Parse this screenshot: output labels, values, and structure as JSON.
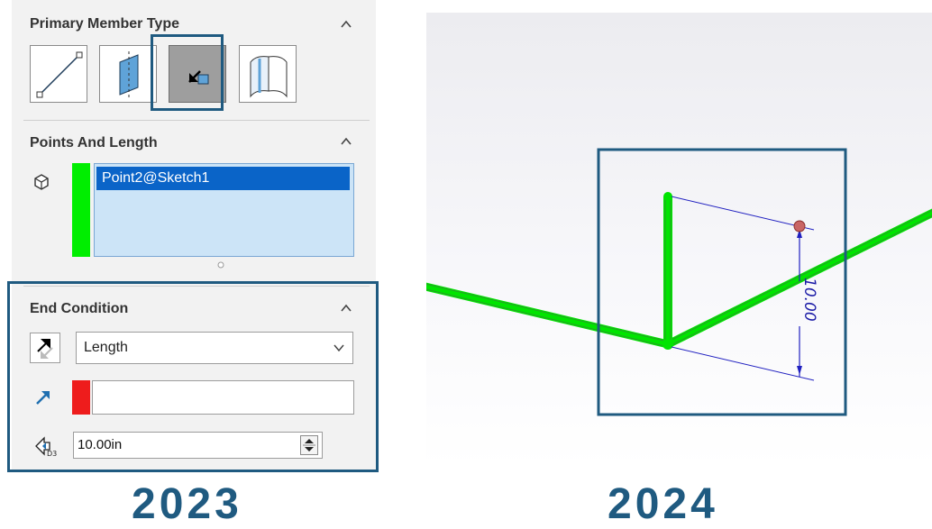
{
  "panel": {
    "primary_member_type": {
      "title": "Primary Member Type",
      "buttons": [
        {
          "name": "line-member-icon",
          "selected": false
        },
        {
          "name": "plane-member-icon",
          "selected": false
        },
        {
          "name": "point-length-member-icon",
          "selected": true
        },
        {
          "name": "surface-member-icon",
          "selected": false
        }
      ]
    },
    "points_and_length": {
      "title": "Points And Length",
      "items": [
        "Point2@Sketch1"
      ]
    },
    "end_condition": {
      "title": "End Condition",
      "type_value": "Length",
      "length_value": "10.00in"
    }
  },
  "viewport": {
    "dimension_text": "10.00"
  },
  "labels": {
    "left_year": "2023",
    "right_year": "2024"
  },
  "colors": {
    "accent": "#1f5a80",
    "member_green": "#00ee00",
    "selection_blue": "#0a64c8",
    "list_bg": "#cce4f7",
    "dimension_blue": "#1a1aa6"
  }
}
